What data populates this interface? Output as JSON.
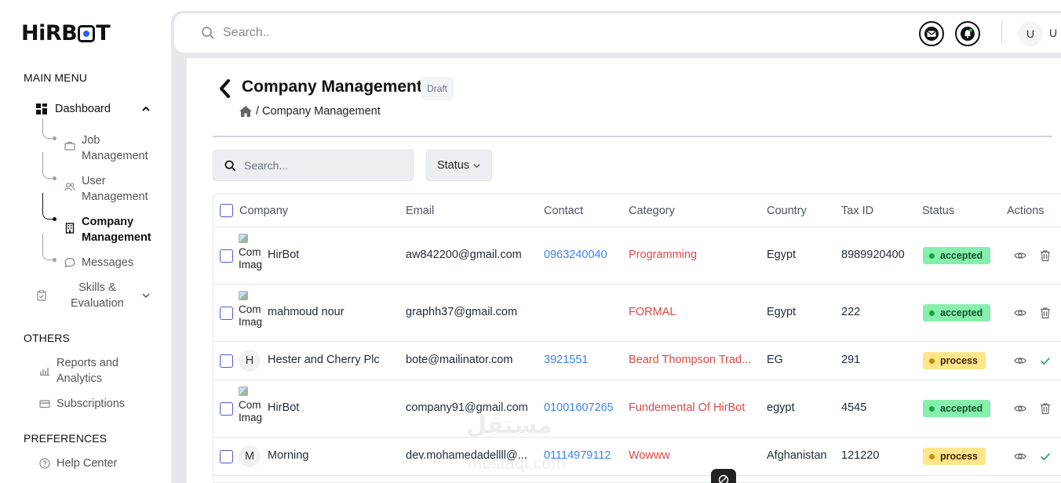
{
  "brand": {
    "logo_text_left": "HiRB",
    "logo_text_right": "T"
  },
  "sidebar": {
    "main_menu_title": "MAIN MENU",
    "dashboard_label": "Dashboard",
    "sub_items": [
      {
        "line1": "Job",
        "line2": "Management"
      },
      {
        "line1": "User",
        "line2": "Management"
      },
      {
        "line1": "Company",
        "line2": "Management"
      },
      {
        "line1": "Messages",
        "line2": ""
      }
    ],
    "skills_line1": "Skills &",
    "skills_line2": "Evaluation",
    "others_title": "OTHERS",
    "reports_line1": "Reports and",
    "reports_line2": "Analytics",
    "subscriptions_label": "Subscriptions",
    "preferences_title": "PREFERENCES",
    "help_label": "Help Center"
  },
  "topbar": {
    "search_placeholder": "Search..",
    "avatar_initial": "U",
    "user_name": "U"
  },
  "page": {
    "title": "Company Management",
    "draft_badge": "Draft",
    "breadcrumb_sep": "/",
    "breadcrumb_current": "Company Management"
  },
  "filters": {
    "search_placeholder": "Search...",
    "status_label": "Status"
  },
  "table": {
    "headers": [
      "Company",
      "Email",
      "Contact",
      "Category",
      "Country",
      "Tax ID",
      "Status",
      "Actions"
    ],
    "rows": [
      {
        "avatar": "Com Imag",
        "company": "HirBot",
        "email": "aw842200@gmail.com",
        "contact": "0963240040",
        "category": "Programming",
        "country": "Egypt",
        "tax_id": "8989920400",
        "status": "accepted"
      },
      {
        "avatar": "Com Imag",
        "company": "mahmoud nour",
        "email": "graphh37@gmail.com",
        "contact": "",
        "category": "FORMAL",
        "country": "Egypt",
        "tax_id": "222",
        "status": "accepted"
      },
      {
        "avatar": "H",
        "company": "Hester and Cherry Plc",
        "email": "bote@mailinator.com",
        "contact": "3921551",
        "category": "Beard Thompson Trad...",
        "country": "EG",
        "tax_id": "291",
        "status": "process"
      },
      {
        "avatar": "Com Imag",
        "company": "HirBot",
        "email": "company91@gmail.com",
        "contact": "01001607265",
        "category": "Fundemental Of HirBot",
        "country": "egypt",
        "tax_id": "4545",
        "status": "accepted"
      },
      {
        "avatar": "M",
        "company": "Morning",
        "email": "dev.mohamedadellll@...",
        "contact": "01114979112",
        "category": "Wowww",
        "country": "Afghanistan",
        "tax_id": "121220",
        "status": "process"
      }
    ]
  },
  "watermark": {
    "arabic": "مستقل",
    "latin": "mostaql.com"
  },
  "colors": {
    "accent": "#3b82f6",
    "category": "#e04747",
    "accepted": "#86efac",
    "process": "#fde68a"
  }
}
